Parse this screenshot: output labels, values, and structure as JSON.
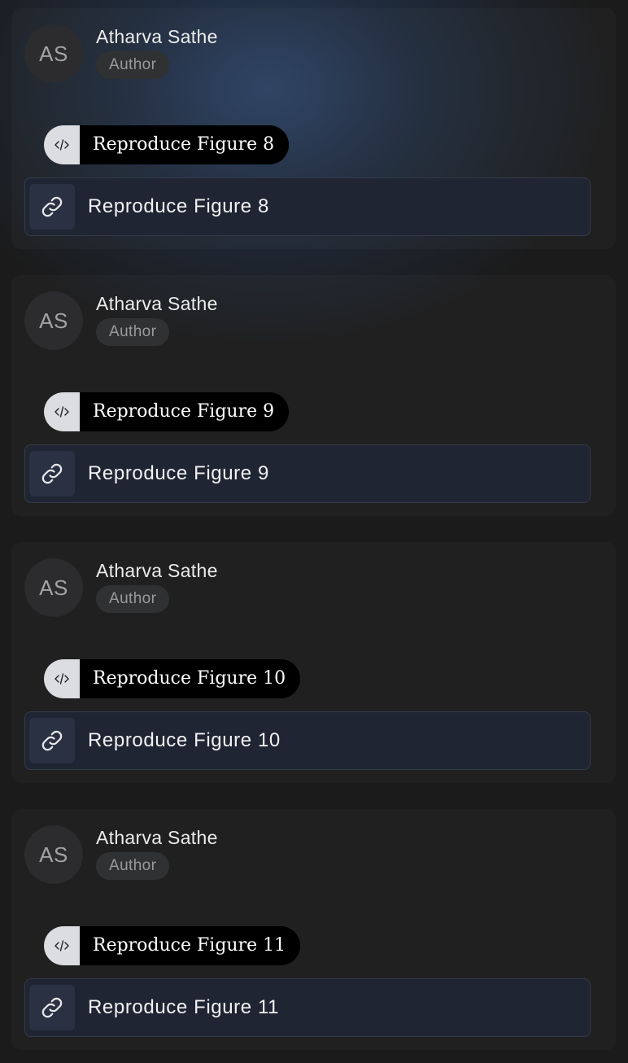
{
  "posts": [
    {
      "author": {
        "initials": "AS",
        "name": "Atharva Sathe",
        "role": "Author"
      },
      "code_pill": {
        "icon": "code-icon",
        "label": "Reproduce Figure 8"
      },
      "link": {
        "icon": "link-icon",
        "label": "Reproduce Figure 8"
      }
    },
    {
      "author": {
        "initials": "AS",
        "name": "Atharva Sathe",
        "role": "Author"
      },
      "code_pill": {
        "icon": "code-icon",
        "label": "Reproduce Figure 9"
      },
      "link": {
        "icon": "link-icon",
        "label": "Reproduce Figure 9"
      }
    },
    {
      "author": {
        "initials": "AS",
        "name": "Atharva Sathe",
        "role": "Author"
      },
      "code_pill": {
        "icon": "code-icon",
        "label": "Reproduce Figure 10"
      },
      "link": {
        "icon": "link-icon",
        "label": "Reproduce Figure 10"
      }
    },
    {
      "author": {
        "initials": "AS",
        "name": "Atharva Sathe",
        "role": "Author"
      },
      "code_pill": {
        "icon": "code-icon",
        "label": "Reproduce Figure 11"
      },
      "link": {
        "icon": "link-icon",
        "label": "Reproduce Figure 11"
      }
    }
  ]
}
